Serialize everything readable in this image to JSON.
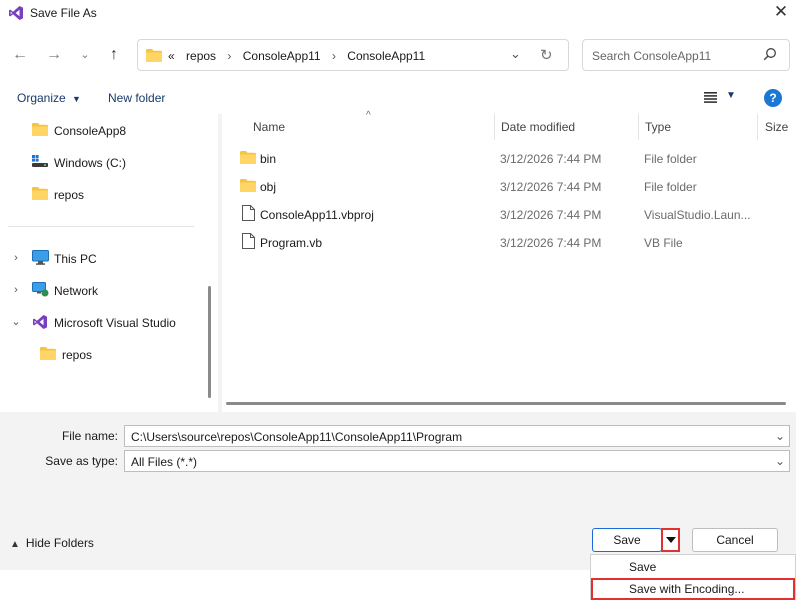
{
  "window": {
    "title": "Save File As"
  },
  "address": {
    "prefix": "«",
    "crumbs": [
      "repos",
      "ConsoleApp11",
      "ConsoleApp11"
    ]
  },
  "search": {
    "placeholder": "Search ConsoleApp11"
  },
  "toolbar": {
    "organize": "Organize",
    "new_folder": "New folder"
  },
  "nav": {
    "items": [
      {
        "label": "ConsoleApp8",
        "icon": "folder-icon"
      },
      {
        "label": "Windows (C:)",
        "icon": "drive-icon"
      },
      {
        "label": "repos",
        "icon": "folder-icon"
      },
      {
        "label": "This PC",
        "icon": "pc-icon"
      },
      {
        "label": "Network",
        "icon": "network-icon"
      },
      {
        "label": "Microsoft Visual Studio",
        "icon": "visual-studio-icon"
      },
      {
        "label": "repos",
        "icon": "folder-icon"
      }
    ]
  },
  "columns": {
    "name": "Name",
    "date": "Date modified",
    "type": "Type",
    "size": "Size"
  },
  "files": [
    {
      "name": "bin",
      "date": "3/12/2026 7:44 PM",
      "type": "File folder",
      "icon": "folder-icon"
    },
    {
      "name": "obj",
      "date": "3/12/2026 7:44 PM",
      "type": "File folder",
      "icon": "folder-icon"
    },
    {
      "name": "ConsoleApp11.vbproj",
      "date": "3/12/2026 7:44 PM",
      "type": "VisualStudio.Laun...",
      "icon": "file-icon"
    },
    {
      "name": "Program.vb",
      "date": "3/12/2026 7:44 PM",
      "type": "VB File",
      "icon": "file-icon"
    }
  ],
  "form": {
    "file_name_label": "File name:",
    "file_name_value": "C:\\Users\\source\\repos\\ConsoleApp11\\ConsoleApp11\\Program",
    "save_type_label": "Save as type:",
    "save_type_value": "All Files (*.*)"
  },
  "footer": {
    "hide_folders": "Hide Folders",
    "save": "Save",
    "cancel": "Cancel"
  },
  "save_menu": {
    "items": [
      "Save",
      "Save with Encoding..."
    ]
  },
  "colors": {
    "accent": "#1a6ad8",
    "highlight": "#e03030",
    "folder": "#f4c542",
    "vs_purple": "#7a3fbf"
  }
}
